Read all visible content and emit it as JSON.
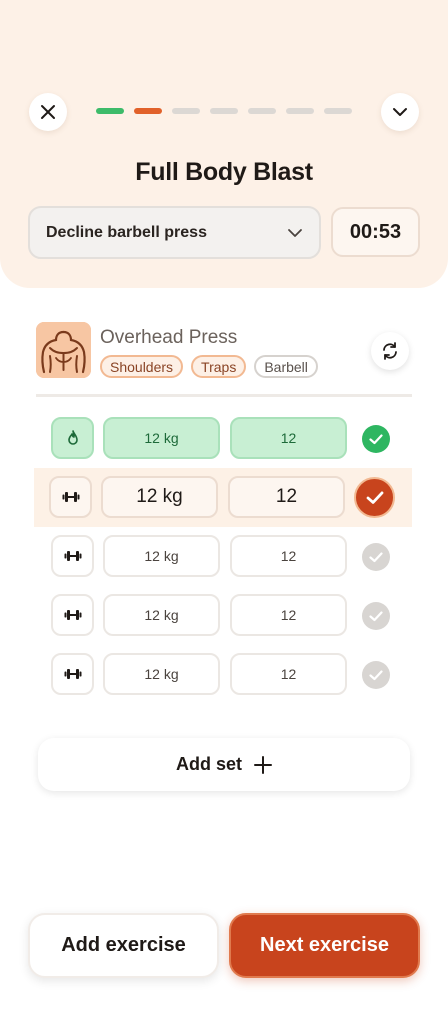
{
  "header": {
    "title": "Full Body Blast",
    "progress": {
      "total": 7,
      "completed": 1,
      "current_index": 1
    },
    "exercise_select": {
      "selected": "Decline barbell press"
    },
    "timer": "00:53"
  },
  "exercise": {
    "name": "Overhead Press",
    "muscle_tags": [
      "Shoulders",
      "Traps"
    ],
    "equipment_tag": "Barbell",
    "thumbnail_icon": "shoulders-muscle-icon"
  },
  "sets": [
    {
      "type_icon": "flame-icon",
      "weight": "12 kg",
      "reps": "12",
      "state": "done"
    },
    {
      "type_icon": "dumbbell-icon",
      "weight": "12 kg",
      "reps": "12",
      "state": "active"
    },
    {
      "type_icon": "dumbbell-icon",
      "weight": "12 kg",
      "reps": "12",
      "state": "pending"
    },
    {
      "type_icon": "dumbbell-icon",
      "weight": "12 kg",
      "reps": "12",
      "state": "pending"
    },
    {
      "type_icon": "dumbbell-icon",
      "weight": "12 kg",
      "reps": "12",
      "state": "pending"
    }
  ],
  "add_set_label": "Add set",
  "footer": {
    "add_exercise_label": "Add exercise",
    "next_exercise_label": "Next exercise"
  },
  "colors": {
    "accent": "#c8441d",
    "progress_done": "#3dbb6a",
    "progress_current": "#e1612a",
    "set_done": "#2eb661",
    "panel_bg": "#fdf1e7"
  }
}
